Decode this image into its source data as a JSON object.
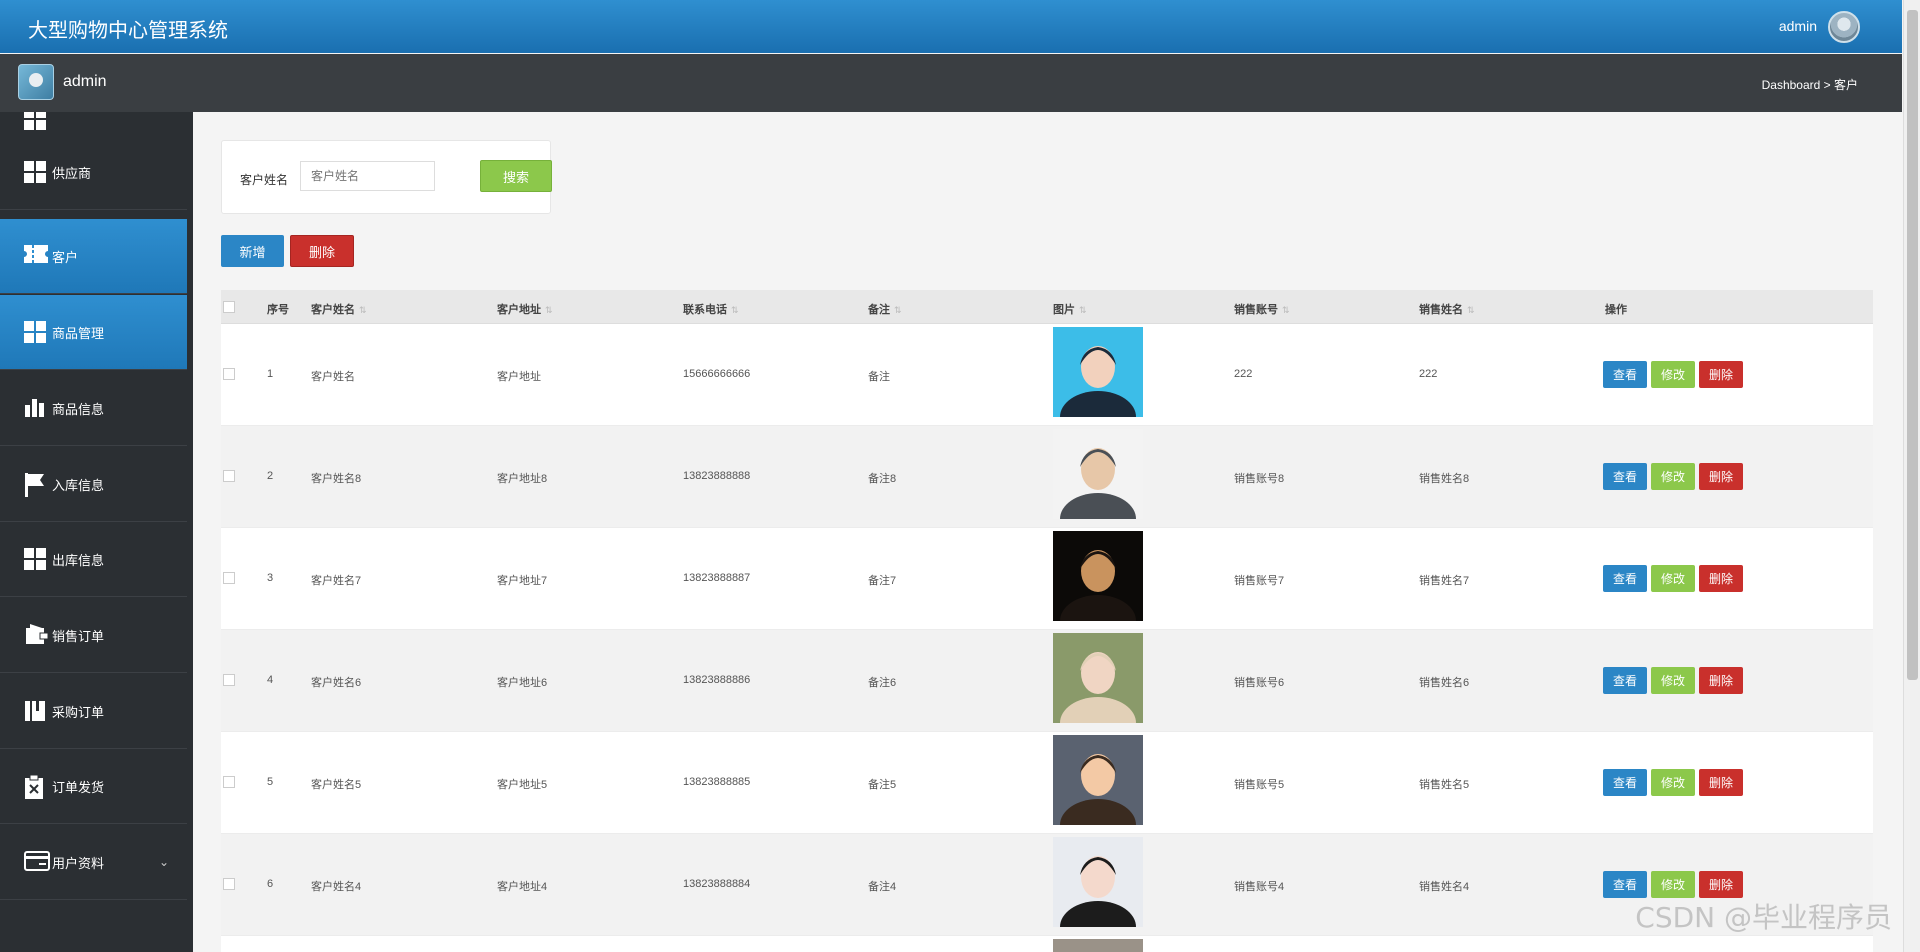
{
  "header": {
    "title": "大型购物中心管理系统",
    "user": "admin"
  },
  "subbar": {
    "name": "admin",
    "breadcrumb": "Dashboard > 客户"
  },
  "sidebar": {
    "items": [
      {
        "label": "供应商",
        "icon": "grid-icon"
      },
      {
        "label": "客户",
        "icon": "ticket-icon",
        "active": true
      },
      {
        "label": "商品管理",
        "icon": "grid-icon",
        "active": true
      },
      {
        "label": "商品信息",
        "icon": "bar-chart-icon"
      },
      {
        "label": "入库信息",
        "icon": "flag-icon"
      },
      {
        "label": "出库信息",
        "icon": "grid-icon"
      },
      {
        "label": "销售订单",
        "icon": "wallet-icon"
      },
      {
        "label": "采购订单",
        "icon": "book-icon"
      },
      {
        "label": "订单发货",
        "icon": "clipboard-x-icon"
      },
      {
        "label": "用户资料",
        "icon": "card-icon",
        "chevron": "⌄"
      }
    ]
  },
  "search": {
    "label": "客户姓名",
    "placeholder": "客户姓名",
    "button": "搜索"
  },
  "toolbar": {
    "add": "新增",
    "delete": "删除"
  },
  "table": {
    "headers": [
      "序号",
      "客户姓名",
      "客户地址",
      "联系电话",
      "备注",
      "图片",
      "销售账号",
      "销售姓名",
      "操作"
    ],
    "actions": {
      "view": "查看",
      "edit": "修改",
      "delete": "删除"
    },
    "rows": [
      {
        "no": "1",
        "name": "客户姓名",
        "addr": "客户地址",
        "phone": "15666666666",
        "note": "备注",
        "acct": "222",
        "seller": "222"
      },
      {
        "no": "2",
        "name": "客户姓名8",
        "addr": "客户地址8",
        "phone": "13823888888",
        "note": "备注8",
        "acct": "销售账号8",
        "seller": "销售姓名8"
      },
      {
        "no": "3",
        "name": "客户姓名7",
        "addr": "客户地址7",
        "phone": "13823888887",
        "note": "备注7",
        "acct": "销售账号7",
        "seller": "销售姓名7"
      },
      {
        "no": "4",
        "name": "客户姓名6",
        "addr": "客户地址6",
        "phone": "13823888886",
        "note": "备注6",
        "acct": "销售账号6",
        "seller": "销售姓名6"
      },
      {
        "no": "5",
        "name": "客户姓名5",
        "addr": "客户地址5",
        "phone": "13823888885",
        "note": "备注5",
        "acct": "销售账号5",
        "seller": "销售姓名5"
      },
      {
        "no": "6",
        "name": "客户姓名4",
        "addr": "客户地址4",
        "phone": "13823888884",
        "note": "备注4",
        "acct": "销售账号4",
        "seller": "销售姓名4"
      }
    ]
  },
  "watermark": "CSDN @毕业程序员",
  "colors": {
    "primary": "#2b86c6",
    "success": "#8cc84b",
    "danger": "#c9302c",
    "sidebar": "#2b2f33"
  }
}
